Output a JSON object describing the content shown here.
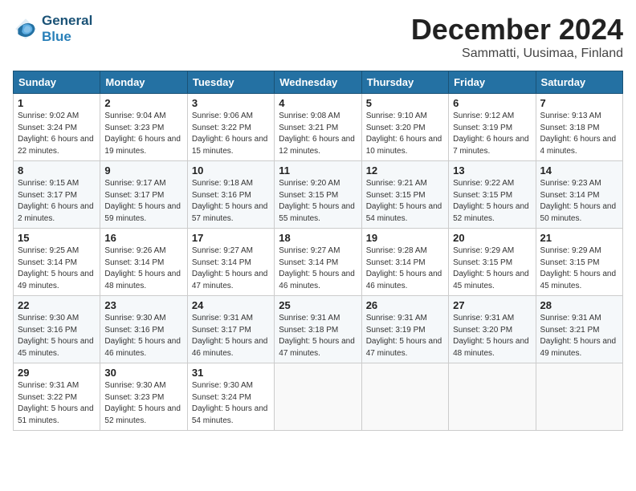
{
  "logo": {
    "line1": "General",
    "line2": "Blue"
  },
  "title": "December 2024",
  "subtitle": "Sammatti, Uusimaa, Finland",
  "columns": [
    "Sunday",
    "Monday",
    "Tuesday",
    "Wednesday",
    "Thursday",
    "Friday",
    "Saturday"
  ],
  "weeks": [
    [
      {
        "day": "1",
        "sunrise": "Sunrise: 9:02 AM",
        "sunset": "Sunset: 3:24 PM",
        "daylight": "Daylight: 6 hours and 22 minutes."
      },
      {
        "day": "2",
        "sunrise": "Sunrise: 9:04 AM",
        "sunset": "Sunset: 3:23 PM",
        "daylight": "Daylight: 6 hours and 19 minutes."
      },
      {
        "day": "3",
        "sunrise": "Sunrise: 9:06 AM",
        "sunset": "Sunset: 3:22 PM",
        "daylight": "Daylight: 6 hours and 15 minutes."
      },
      {
        "day": "4",
        "sunrise": "Sunrise: 9:08 AM",
        "sunset": "Sunset: 3:21 PM",
        "daylight": "Daylight: 6 hours and 12 minutes."
      },
      {
        "day": "5",
        "sunrise": "Sunrise: 9:10 AM",
        "sunset": "Sunset: 3:20 PM",
        "daylight": "Daylight: 6 hours and 10 minutes."
      },
      {
        "day": "6",
        "sunrise": "Sunrise: 9:12 AM",
        "sunset": "Sunset: 3:19 PM",
        "daylight": "Daylight: 6 hours and 7 minutes."
      },
      {
        "day": "7",
        "sunrise": "Sunrise: 9:13 AM",
        "sunset": "Sunset: 3:18 PM",
        "daylight": "Daylight: 6 hours and 4 minutes."
      }
    ],
    [
      {
        "day": "8",
        "sunrise": "Sunrise: 9:15 AM",
        "sunset": "Sunset: 3:17 PM",
        "daylight": "Daylight: 6 hours and 2 minutes."
      },
      {
        "day": "9",
        "sunrise": "Sunrise: 9:17 AM",
        "sunset": "Sunset: 3:17 PM",
        "daylight": "Daylight: 5 hours and 59 minutes."
      },
      {
        "day": "10",
        "sunrise": "Sunrise: 9:18 AM",
        "sunset": "Sunset: 3:16 PM",
        "daylight": "Daylight: 5 hours and 57 minutes."
      },
      {
        "day": "11",
        "sunrise": "Sunrise: 9:20 AM",
        "sunset": "Sunset: 3:15 PM",
        "daylight": "Daylight: 5 hours and 55 minutes."
      },
      {
        "day": "12",
        "sunrise": "Sunrise: 9:21 AM",
        "sunset": "Sunset: 3:15 PM",
        "daylight": "Daylight: 5 hours and 54 minutes."
      },
      {
        "day": "13",
        "sunrise": "Sunrise: 9:22 AM",
        "sunset": "Sunset: 3:15 PM",
        "daylight": "Daylight: 5 hours and 52 minutes."
      },
      {
        "day": "14",
        "sunrise": "Sunrise: 9:23 AM",
        "sunset": "Sunset: 3:14 PM",
        "daylight": "Daylight: 5 hours and 50 minutes."
      }
    ],
    [
      {
        "day": "15",
        "sunrise": "Sunrise: 9:25 AM",
        "sunset": "Sunset: 3:14 PM",
        "daylight": "Daylight: 5 hours and 49 minutes."
      },
      {
        "day": "16",
        "sunrise": "Sunrise: 9:26 AM",
        "sunset": "Sunset: 3:14 PM",
        "daylight": "Daylight: 5 hours and 48 minutes."
      },
      {
        "day": "17",
        "sunrise": "Sunrise: 9:27 AM",
        "sunset": "Sunset: 3:14 PM",
        "daylight": "Daylight: 5 hours and 47 minutes."
      },
      {
        "day": "18",
        "sunrise": "Sunrise: 9:27 AM",
        "sunset": "Sunset: 3:14 PM",
        "daylight": "Daylight: 5 hours and 46 minutes."
      },
      {
        "day": "19",
        "sunrise": "Sunrise: 9:28 AM",
        "sunset": "Sunset: 3:14 PM",
        "daylight": "Daylight: 5 hours and 46 minutes."
      },
      {
        "day": "20",
        "sunrise": "Sunrise: 9:29 AM",
        "sunset": "Sunset: 3:15 PM",
        "daylight": "Daylight: 5 hours and 45 minutes."
      },
      {
        "day": "21",
        "sunrise": "Sunrise: 9:29 AM",
        "sunset": "Sunset: 3:15 PM",
        "daylight": "Daylight: 5 hours and 45 minutes."
      }
    ],
    [
      {
        "day": "22",
        "sunrise": "Sunrise: 9:30 AM",
        "sunset": "Sunset: 3:16 PM",
        "daylight": "Daylight: 5 hours and 45 minutes."
      },
      {
        "day": "23",
        "sunrise": "Sunrise: 9:30 AM",
        "sunset": "Sunset: 3:16 PM",
        "daylight": "Daylight: 5 hours and 46 minutes."
      },
      {
        "day": "24",
        "sunrise": "Sunrise: 9:31 AM",
        "sunset": "Sunset: 3:17 PM",
        "daylight": "Daylight: 5 hours and 46 minutes."
      },
      {
        "day": "25",
        "sunrise": "Sunrise: 9:31 AM",
        "sunset": "Sunset: 3:18 PM",
        "daylight": "Daylight: 5 hours and 47 minutes."
      },
      {
        "day": "26",
        "sunrise": "Sunrise: 9:31 AM",
        "sunset": "Sunset: 3:19 PM",
        "daylight": "Daylight: 5 hours and 47 minutes."
      },
      {
        "day": "27",
        "sunrise": "Sunrise: 9:31 AM",
        "sunset": "Sunset: 3:20 PM",
        "daylight": "Daylight: 5 hours and 48 minutes."
      },
      {
        "day": "28",
        "sunrise": "Sunrise: 9:31 AM",
        "sunset": "Sunset: 3:21 PM",
        "daylight": "Daylight: 5 hours and 49 minutes."
      }
    ],
    [
      {
        "day": "29",
        "sunrise": "Sunrise: 9:31 AM",
        "sunset": "Sunset: 3:22 PM",
        "daylight": "Daylight: 5 hours and 51 minutes."
      },
      {
        "day": "30",
        "sunrise": "Sunrise: 9:30 AM",
        "sunset": "Sunset: 3:23 PM",
        "daylight": "Daylight: 5 hours and 52 minutes."
      },
      {
        "day": "31",
        "sunrise": "Sunrise: 9:30 AM",
        "sunset": "Sunset: 3:24 PM",
        "daylight": "Daylight: 5 hours and 54 minutes."
      },
      null,
      null,
      null,
      null
    ]
  ]
}
